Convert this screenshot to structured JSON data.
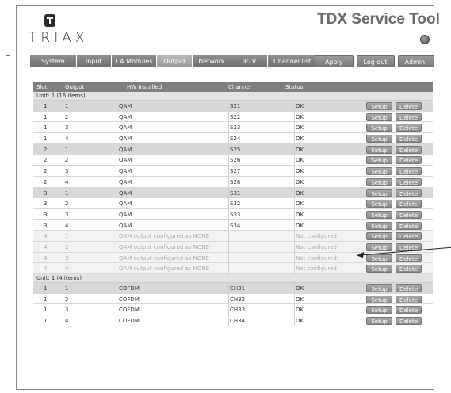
{
  "brand": {
    "logo_text": "TRIAX",
    "app_title": "TDX Service Tool"
  },
  "nav": {
    "tabs": [
      "System",
      "Input",
      "CA Modules",
      "Output",
      "Network",
      "IPTV",
      "Channel list"
    ],
    "active": "Output"
  },
  "actions": {
    "apply": "Apply",
    "logout": "Log out",
    "admin": "Admin."
  },
  "table": {
    "headers": {
      "slot": "Slot",
      "output": "Output",
      "hw": "HW Installed",
      "channel": "Channel",
      "status": "Status"
    },
    "setup_label": "Setup",
    "delete_label": "Delete",
    "groups": [
      {
        "label": "Unit: 1 (16 items)",
        "rows": [
          {
            "slot": "1",
            "output": "1",
            "hw": "QAM",
            "channel": "S21",
            "status": "OK",
            "style": "shade"
          },
          {
            "slot": "1",
            "output": "2",
            "hw": "QAM",
            "channel": "S22",
            "status": "OK",
            "style": ""
          },
          {
            "slot": "1",
            "output": "3",
            "hw": "QAM",
            "channel": "S23",
            "status": "OK",
            "style": ""
          },
          {
            "slot": "1",
            "output": "4",
            "hw": "QAM",
            "channel": "S24",
            "status": "OK",
            "style": ""
          },
          {
            "slot": "2",
            "output": "1",
            "hw": "QAM",
            "channel": "S25",
            "status": "OK",
            "style": "shade"
          },
          {
            "slot": "2",
            "output": "2",
            "hw": "QAM",
            "channel": "S26",
            "status": "OK",
            "style": ""
          },
          {
            "slot": "2",
            "output": "3",
            "hw": "QAM",
            "channel": "S27",
            "status": "OK",
            "style": ""
          },
          {
            "slot": "2",
            "output": "4",
            "hw": "QAM",
            "channel": "S28",
            "status": "OK",
            "style": ""
          },
          {
            "slot": "3",
            "output": "1",
            "hw": "QAM",
            "channel": "S31",
            "status": "OK",
            "style": "shade"
          },
          {
            "slot": "3",
            "output": "2",
            "hw": "QAM",
            "channel": "S32",
            "status": "OK",
            "style": ""
          },
          {
            "slot": "3",
            "output": "3",
            "hw": "QAM",
            "channel": "S33",
            "status": "OK",
            "style": ""
          },
          {
            "slot": "3",
            "output": "4",
            "hw": "QAM",
            "channel": "S34",
            "status": "OK",
            "style": ""
          },
          {
            "slot": "4",
            "output": "1",
            "hw": "QAM output configured as NONE",
            "channel": "",
            "status": "Not configured",
            "style": "dim"
          },
          {
            "slot": "4",
            "output": "2",
            "hw": "QAM output configured as NONE",
            "channel": "",
            "status": "Not configured",
            "style": "dim"
          },
          {
            "slot": "4",
            "output": "3",
            "hw": "QAM output configured as NONE",
            "channel": "",
            "status": "Not configured",
            "style": "dim"
          },
          {
            "slot": "4",
            "output": "4",
            "hw": "QAM output configured as NONE",
            "channel": "",
            "status": "Not configured",
            "style": "dim"
          }
        ]
      },
      {
        "label": "Unit: 1 (4 items)",
        "rows": [
          {
            "slot": "1",
            "output": "1",
            "hw": "COFDM",
            "channel": "CH31",
            "status": "OK",
            "style": "shade"
          },
          {
            "slot": "1",
            "output": "2",
            "hw": "COFDM",
            "channel": "CH32",
            "status": "OK",
            "style": ""
          },
          {
            "slot": "1",
            "output": "3",
            "hw": "COFDM",
            "channel": "CH33",
            "status": "OK",
            "style": ""
          },
          {
            "slot": "1",
            "output": "4",
            "hw": "COFDM",
            "channel": "CH34",
            "status": "OK",
            "style": ""
          }
        ]
      }
    ]
  }
}
